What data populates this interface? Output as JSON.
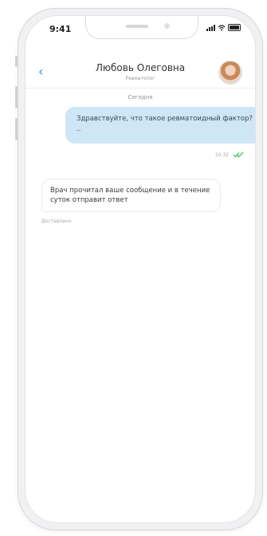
{
  "status_bar": {
    "time": "9:41"
  },
  "header": {
    "back_icon": "chevron-left-icon",
    "title": "Любовь Олеговна",
    "subtitle": "Ревматолог",
    "avatar_icon": "user-photo-avatar"
  },
  "chat": {
    "date_separator": "Сегодня",
    "messages": [
      {
        "direction": "outgoing",
        "text": "Здравствуйте, что такое ревматоидный фактор? ..",
        "time": "10:32",
        "status_icon": "double-check-icon"
      },
      {
        "direction": "incoming",
        "text": "Врач прочитал ваше сообщение и в течение суток отправит ответ",
        "meta": "Доставлено"
      }
    ]
  },
  "colors": {
    "accent": "#2a8ad8",
    "outgoing_bubble": "#cfe6f7",
    "read_check": "#4cc96a"
  }
}
